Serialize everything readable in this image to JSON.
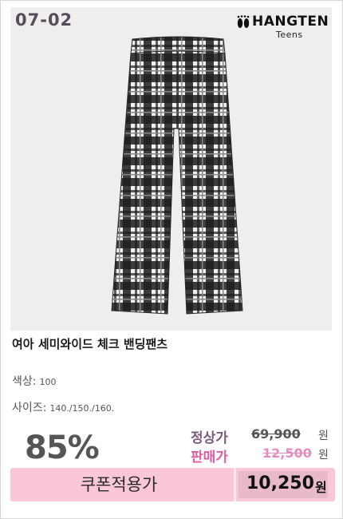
{
  "product": {
    "code": "07-02",
    "brand_name": "HANGTEN",
    "brand_sub": "Teens",
    "title": "여아 세미와이드 체크 밴딩팬츠"
  },
  "specs": {
    "color_label": "색상",
    "color_value": "100",
    "size_label": "사이즈",
    "size_value": "140./150./160."
  },
  "pricing": {
    "discount": "85%",
    "regular_label": "정상가",
    "regular_price": "69,900",
    "sale_label": "판매가",
    "sale_price": "12,500",
    "currency": "원"
  },
  "coupon": {
    "label": "쿠폰적용가",
    "price": "10,250",
    "currency": "원"
  },
  "colors": {
    "code": "#564d5c",
    "sale_label": "#e55aa0",
    "coupon_bar": "#f9c7d7",
    "coupon_price_bg": "#e7b9ca"
  }
}
